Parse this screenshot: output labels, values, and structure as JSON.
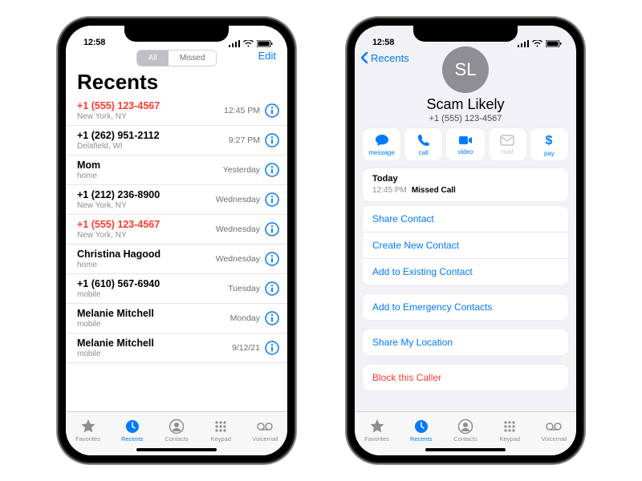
{
  "status": {
    "time": "12:58"
  },
  "colors": {
    "accent": "#007aff",
    "danger": "#ff3b30",
    "secondary": "#8e8e93"
  },
  "phone1": {
    "segmented": {
      "all": "All",
      "missed": "Missed"
    },
    "edit": "Edit",
    "title": "Recents",
    "rows": [
      {
        "primary": "+1 (555) 123-4567",
        "secondary": "New York, NY",
        "timestamp": "12:45 PM",
        "missed": true
      },
      {
        "primary": "+1 (262) 951-2112",
        "secondary": "Delafield, WI",
        "timestamp": "9:27 PM",
        "missed": false
      },
      {
        "primary": "Mom",
        "secondary": "home",
        "timestamp": "Yesterday",
        "missed": false
      },
      {
        "primary": "+1 (212) 236-8900",
        "secondary": "New York, NY",
        "timestamp": "Wednesday",
        "missed": false
      },
      {
        "primary": "+1 (555) 123-4567",
        "secondary": "New York, NY",
        "timestamp": "Wednesday",
        "missed": true
      },
      {
        "primary": "Christina Hagood",
        "secondary": "home",
        "timestamp": "Wednesday",
        "missed": false
      },
      {
        "primary": "+1 (610) 567-6940",
        "secondary": "mobile",
        "timestamp": "Tuesday",
        "missed": false
      },
      {
        "primary": "Melanie Mitchell",
        "secondary": "mobile",
        "timestamp": "Monday",
        "missed": false
      },
      {
        "primary": "Melanie Mitchell",
        "secondary": "mobile",
        "timestamp": "9/12/21",
        "missed": false
      }
    ]
  },
  "tabs": [
    {
      "label": "Favorites",
      "icon": "star-icon"
    },
    {
      "label": "Recents",
      "icon": "clock-icon"
    },
    {
      "label": "Contacts",
      "icon": "contact-icon"
    },
    {
      "label": "Keypad",
      "icon": "keypad-icon"
    },
    {
      "label": "Voicemail",
      "icon": "voicemail-icon"
    }
  ],
  "phone2": {
    "back": "Recents",
    "initials": "SL",
    "name": "Scam Likely",
    "phone": "+1 (555) 123-4567",
    "actions": [
      {
        "label": "message",
        "icon": "message-icon",
        "enabled": true
      },
      {
        "label": "call",
        "icon": "phone-icon",
        "enabled": true
      },
      {
        "label": "video",
        "icon": "video-icon",
        "enabled": true
      },
      {
        "label": "mail",
        "icon": "mail-icon",
        "enabled": false
      },
      {
        "label": "pay",
        "icon": "dollar-icon",
        "enabled": true
      }
    ],
    "today": {
      "header": "Today",
      "time": "12:45 PM",
      "label": "Missed Call"
    },
    "groupA": [
      "Share Contact",
      "Create New Contact",
      "Add to Existing Contact"
    ],
    "groupB": [
      "Add to Emergency Contacts"
    ],
    "groupC": [
      "Share My Location"
    ],
    "block": "Block this Caller"
  }
}
